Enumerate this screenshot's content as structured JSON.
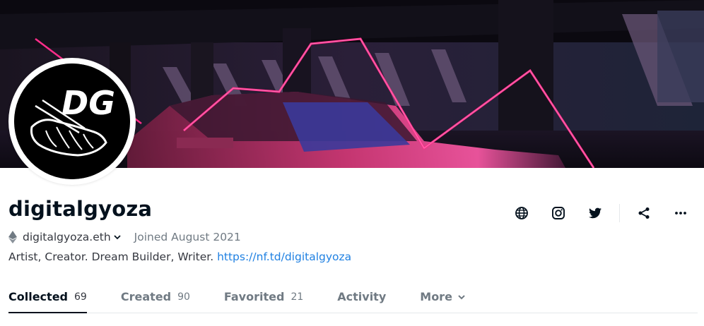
{
  "profile": {
    "username": "digitalgyoza",
    "wallet": "digitalgyoza.eth",
    "joined": "Joined August 2021",
    "bio_text": "Artist, Creator. Dream Builder, Writer.",
    "bio_link": "https://nf.td/digitalgyoza",
    "avatar_monogram": "DG"
  },
  "actions": {
    "icons": [
      "globe-icon",
      "instagram-icon",
      "twitter-icon",
      "share-icon",
      "more-icon"
    ]
  },
  "tabs": [
    {
      "label": "Collected",
      "count": "69",
      "active": true
    },
    {
      "label": "Created",
      "count": "90",
      "active": false
    },
    {
      "label": "Favorited",
      "count": "21",
      "active": false
    },
    {
      "label": "Activity",
      "count": "",
      "active": false
    },
    {
      "label": "More",
      "count": "",
      "active": false
    }
  ],
  "colors": {
    "link": "#2081e2",
    "text_primary": "#04111d",
    "text_secondary": "#707a83",
    "neon": "#ff2d8a"
  }
}
